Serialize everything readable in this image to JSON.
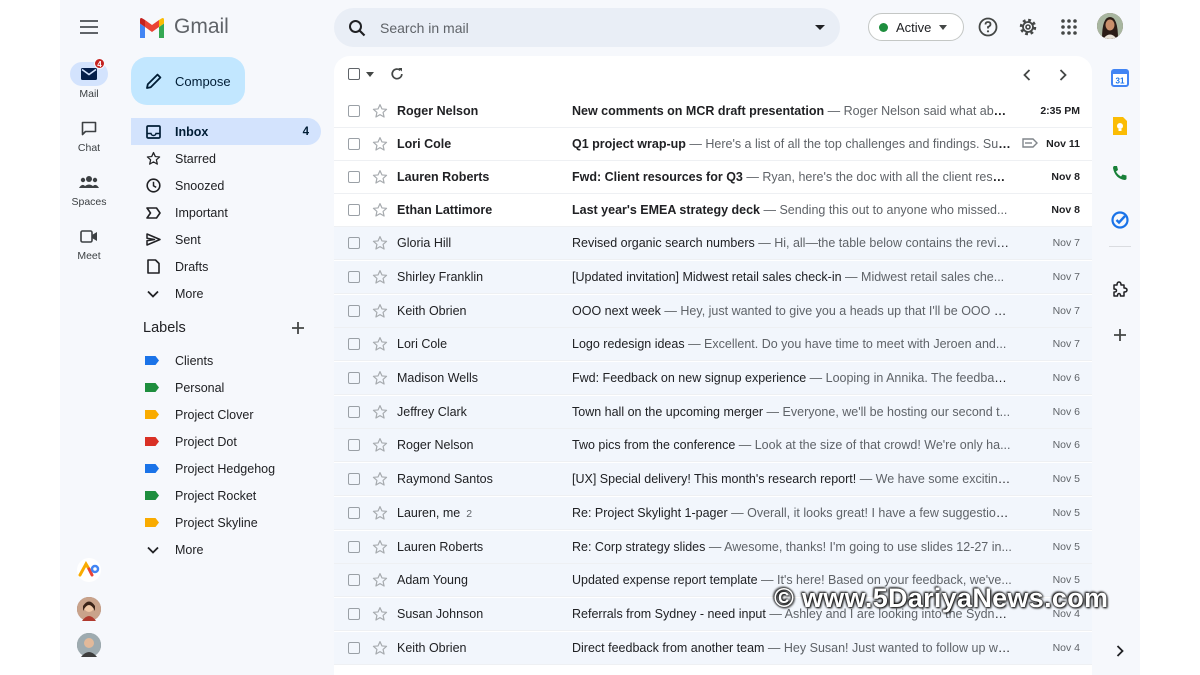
{
  "app": {
    "name": "Gmail"
  },
  "rail": {
    "items": [
      {
        "label": "Mail",
        "badge": "4"
      },
      {
        "label": "Chat"
      },
      {
        "label": "Spaces"
      },
      {
        "label": "Meet"
      }
    ]
  },
  "search": {
    "placeholder": "Search in mail"
  },
  "status": {
    "label": "Active",
    "color": "#1e8e3e"
  },
  "compose": {
    "label": "Compose"
  },
  "nav": [
    {
      "label": "Inbox",
      "icon": "inbox-icon",
      "count": "4"
    },
    {
      "label": "Starred",
      "icon": "star-icon"
    },
    {
      "label": "Snoozed",
      "icon": "clock-icon"
    },
    {
      "label": "Important",
      "icon": "important-icon"
    },
    {
      "label": "Sent",
      "icon": "send-icon"
    },
    {
      "label": "Drafts",
      "icon": "draft-icon"
    },
    {
      "label": "More",
      "icon": "chevron-down-icon"
    }
  ],
  "labels": {
    "title": "Labels",
    "items": [
      {
        "label": "Clients",
        "color": "#1a73e8"
      },
      {
        "label": "Personal",
        "color": "#1e8e3e"
      },
      {
        "label": "Project Clover",
        "color": "#f9ab00"
      },
      {
        "label": "Project Dot",
        "color": "#d93025"
      },
      {
        "label": "Project Hedgehog",
        "color": "#1a73e8"
      },
      {
        "label": "Project Rocket",
        "color": "#1e8e3e"
      },
      {
        "label": "Project Skyline",
        "color": "#f9ab00"
      }
    ],
    "more": "More"
  },
  "emails": [
    {
      "sender": "Roger Nelson",
      "subject": "New comments on MCR draft presentation",
      "snippet": "Roger Nelson said what abou...",
      "date": "2:35 PM",
      "unread": true
    },
    {
      "sender": "Lori Cole",
      "subject": "Q1 project wrap-up",
      "snippet": "Here's a list of all the top challenges and findings. Sur...",
      "date": "Nov 11",
      "unread": true,
      "tag": true
    },
    {
      "sender": "Lauren Roberts",
      "subject": "Fwd: Client resources for Q3",
      "snippet": "Ryan, here's the doc with all the client resou...",
      "date": "Nov 8",
      "unread": true
    },
    {
      "sender": "Ethan Lattimore",
      "subject": "Last year's EMEA strategy deck",
      "snippet": "Sending this out to anyone who missed...",
      "date": "Nov 8",
      "unread": true
    },
    {
      "sender": "Gloria Hill",
      "subject": "Revised organic search numbers",
      "snippet": "Hi, all—the table below contains the revise...",
      "date": "Nov 7",
      "unread": false
    },
    {
      "sender": "Shirley Franklin",
      "subject": "[Updated invitation] Midwest retail sales check-in",
      "snippet": "Midwest retail sales che...",
      "date": "Nov 7",
      "unread": false
    },
    {
      "sender": "Keith Obrien",
      "subject": "OOO next week",
      "snippet": "Hey, just wanted to give you a heads up that I'll be OOO ne...",
      "date": "Nov 7",
      "unread": false
    },
    {
      "sender": "Lori Cole",
      "subject": "Logo redesign ideas",
      "snippet": "Excellent. Do you have time to meet with Jeroen and...",
      "date": "Nov 7",
      "unread": false
    },
    {
      "sender": "Madison Wells",
      "subject": "Fwd: Feedback on new signup experience",
      "snippet": "Looping in Annika. The feedback...",
      "date": "Nov 6",
      "unread": false
    },
    {
      "sender": "Jeffrey Clark",
      "subject": "Town hall on the upcoming merger",
      "snippet": "Everyone, we'll be hosting our second t...",
      "date": "Nov 6",
      "unread": false
    },
    {
      "sender": "Roger Nelson",
      "subject": "Two pics from the conference",
      "snippet": "Look at the size of that crowd! We're only ha...",
      "date": "Nov 6",
      "unread": false
    },
    {
      "sender": "Raymond Santos",
      "subject": "[UX] Special delivery! This month's research report!",
      "snippet": "We have some exciting...",
      "date": "Nov 5",
      "unread": false
    },
    {
      "sender": "Lauren, me",
      "thread_count": "2",
      "subject": "Re: Project Skylight 1-pager",
      "snippet": "Overall, it looks great! I have a few suggestions...",
      "date": "Nov 5",
      "unread": false
    },
    {
      "sender": "Lauren Roberts",
      "subject": "Re: Corp strategy slides",
      "snippet": "Awesome, thanks! I'm going to use slides 12-27 in...",
      "date": "Nov 5",
      "unread": false
    },
    {
      "sender": "Adam Young",
      "subject": "Updated expense report template",
      "snippet": "It's here! Based on your feedback, we've...",
      "date": "Nov 5",
      "unread": false
    },
    {
      "sender": "Susan Johnson",
      "subject": "Referrals from Sydney - need input",
      "snippet": "Ashley and I are looking into the Sydney ...",
      "date": "Nov 4",
      "unread": false
    },
    {
      "sender": "Keith Obrien",
      "subject": "Direct feedback from another team",
      "snippet": "Hey Susan! Just wanted to follow up with s...",
      "date": "Nov 4",
      "unread": false
    }
  ],
  "watermark": "© www.5DariyaNews.com"
}
